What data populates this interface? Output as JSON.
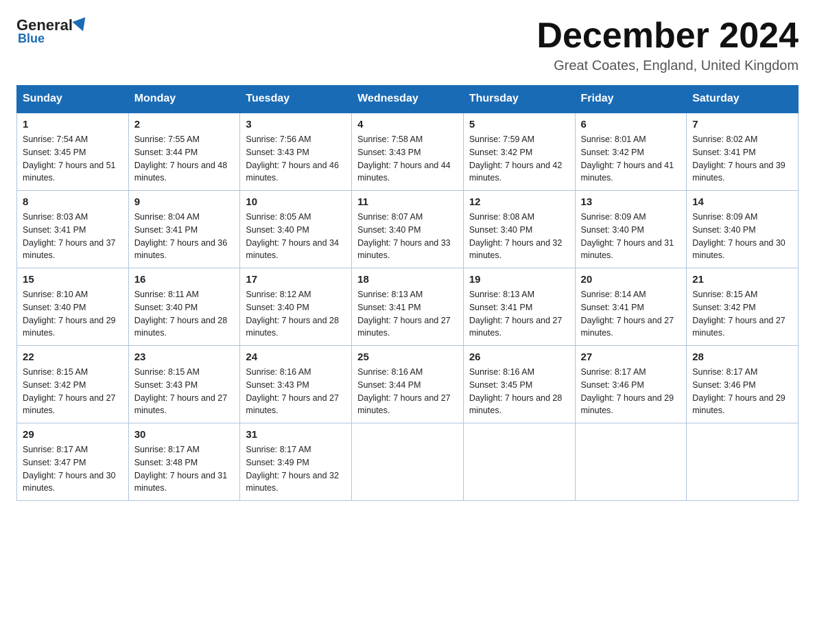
{
  "logo": {
    "general": "General",
    "blue": "Blue"
  },
  "title": "December 2024",
  "subtitle": "Great Coates, England, United Kingdom",
  "weekdays": [
    "Sunday",
    "Monday",
    "Tuesday",
    "Wednesday",
    "Thursday",
    "Friday",
    "Saturday"
  ],
  "weeks": [
    [
      {
        "day": "1",
        "sunrise": "7:54 AM",
        "sunset": "3:45 PM",
        "daylight": "7 hours and 51 minutes."
      },
      {
        "day": "2",
        "sunrise": "7:55 AM",
        "sunset": "3:44 PM",
        "daylight": "7 hours and 48 minutes."
      },
      {
        "day": "3",
        "sunrise": "7:56 AM",
        "sunset": "3:43 PM",
        "daylight": "7 hours and 46 minutes."
      },
      {
        "day": "4",
        "sunrise": "7:58 AM",
        "sunset": "3:43 PM",
        "daylight": "7 hours and 44 minutes."
      },
      {
        "day": "5",
        "sunrise": "7:59 AM",
        "sunset": "3:42 PM",
        "daylight": "7 hours and 42 minutes."
      },
      {
        "day": "6",
        "sunrise": "8:01 AM",
        "sunset": "3:42 PM",
        "daylight": "7 hours and 41 minutes."
      },
      {
        "day": "7",
        "sunrise": "8:02 AM",
        "sunset": "3:41 PM",
        "daylight": "7 hours and 39 minutes."
      }
    ],
    [
      {
        "day": "8",
        "sunrise": "8:03 AM",
        "sunset": "3:41 PM",
        "daylight": "7 hours and 37 minutes."
      },
      {
        "day": "9",
        "sunrise": "8:04 AM",
        "sunset": "3:41 PM",
        "daylight": "7 hours and 36 minutes."
      },
      {
        "day": "10",
        "sunrise": "8:05 AM",
        "sunset": "3:40 PM",
        "daylight": "7 hours and 34 minutes."
      },
      {
        "day": "11",
        "sunrise": "8:07 AM",
        "sunset": "3:40 PM",
        "daylight": "7 hours and 33 minutes."
      },
      {
        "day": "12",
        "sunrise": "8:08 AM",
        "sunset": "3:40 PM",
        "daylight": "7 hours and 32 minutes."
      },
      {
        "day": "13",
        "sunrise": "8:09 AM",
        "sunset": "3:40 PM",
        "daylight": "7 hours and 31 minutes."
      },
      {
        "day": "14",
        "sunrise": "8:09 AM",
        "sunset": "3:40 PM",
        "daylight": "7 hours and 30 minutes."
      }
    ],
    [
      {
        "day": "15",
        "sunrise": "8:10 AM",
        "sunset": "3:40 PM",
        "daylight": "7 hours and 29 minutes."
      },
      {
        "day": "16",
        "sunrise": "8:11 AM",
        "sunset": "3:40 PM",
        "daylight": "7 hours and 28 minutes."
      },
      {
        "day": "17",
        "sunrise": "8:12 AM",
        "sunset": "3:40 PM",
        "daylight": "7 hours and 28 minutes."
      },
      {
        "day": "18",
        "sunrise": "8:13 AM",
        "sunset": "3:41 PM",
        "daylight": "7 hours and 27 minutes."
      },
      {
        "day": "19",
        "sunrise": "8:13 AM",
        "sunset": "3:41 PM",
        "daylight": "7 hours and 27 minutes."
      },
      {
        "day": "20",
        "sunrise": "8:14 AM",
        "sunset": "3:41 PM",
        "daylight": "7 hours and 27 minutes."
      },
      {
        "day": "21",
        "sunrise": "8:15 AM",
        "sunset": "3:42 PM",
        "daylight": "7 hours and 27 minutes."
      }
    ],
    [
      {
        "day": "22",
        "sunrise": "8:15 AM",
        "sunset": "3:42 PM",
        "daylight": "7 hours and 27 minutes."
      },
      {
        "day": "23",
        "sunrise": "8:15 AM",
        "sunset": "3:43 PM",
        "daylight": "7 hours and 27 minutes."
      },
      {
        "day": "24",
        "sunrise": "8:16 AM",
        "sunset": "3:43 PM",
        "daylight": "7 hours and 27 minutes."
      },
      {
        "day": "25",
        "sunrise": "8:16 AM",
        "sunset": "3:44 PM",
        "daylight": "7 hours and 27 minutes."
      },
      {
        "day": "26",
        "sunrise": "8:16 AM",
        "sunset": "3:45 PM",
        "daylight": "7 hours and 28 minutes."
      },
      {
        "day": "27",
        "sunrise": "8:17 AM",
        "sunset": "3:46 PM",
        "daylight": "7 hours and 29 minutes."
      },
      {
        "day": "28",
        "sunrise": "8:17 AM",
        "sunset": "3:46 PM",
        "daylight": "7 hours and 29 minutes."
      }
    ],
    [
      {
        "day": "29",
        "sunrise": "8:17 AM",
        "sunset": "3:47 PM",
        "daylight": "7 hours and 30 minutes."
      },
      {
        "day": "30",
        "sunrise": "8:17 AM",
        "sunset": "3:48 PM",
        "daylight": "7 hours and 31 minutes."
      },
      {
        "day": "31",
        "sunrise": "8:17 AM",
        "sunset": "3:49 PM",
        "daylight": "7 hours and 32 minutes."
      },
      null,
      null,
      null,
      null
    ]
  ]
}
